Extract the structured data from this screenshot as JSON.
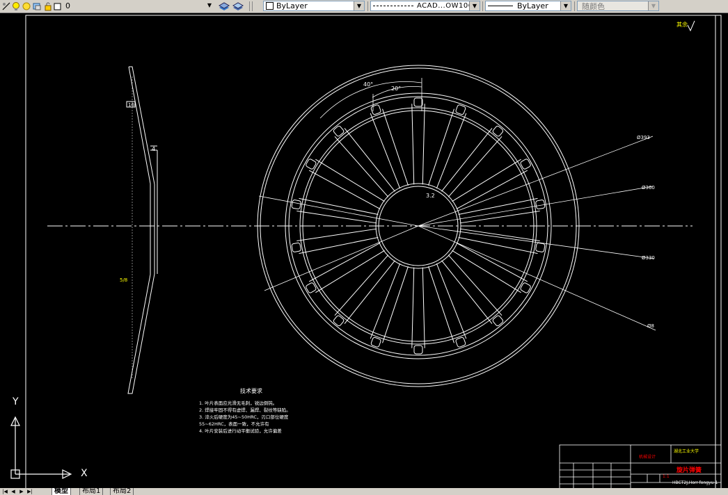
{
  "toolbar": {
    "layer_value": "0",
    "color_value": "ByLayer",
    "linetype_value": "ACAD...OW10C",
    "lineweight_value": "ByLayer",
    "plotstyle_value": "随颜色"
  },
  "tabs": {
    "model": "模型",
    "layout1": "布局1",
    "layout2": "布局2"
  },
  "drawing": {
    "notes_title": "技术要求",
    "notes": [
      "1. 叶片表面应光滑无毛刺，锐边倒钝。",
      "2. 焊接牢固不得有虚焊、漏焊、裂纹等缺陷。",
      "3. 淬火后硬度为45~50HRC，刃口部位硬度",
      "55~62HRC，表面一致，不允许有",
      "4. 叶片安装后进行动平衡试验，允许偏差"
    ],
    "dim_labels": {
      "angle_40": "40°",
      "angle_20": "20°",
      "d_outer": "Ø393",
      "d_mid": "Ø360",
      "d_inner": "Ø330",
      "d_small": "Ø8",
      "r_center": "3.2",
      "side_thick": "4",
      "side_16": "16",
      "side_note": "5/8"
    },
    "title_block": {
      "part_name": "旋片弹簧",
      "drawing_no": "HBCT2J,Horr-fongyu-1",
      "scale": "1:1",
      "org_text_1": "机械设计",
      "company": "湖北工业大学"
    },
    "ucs": {
      "x": "X",
      "y": "Y"
    },
    "roughness": "其余"
  },
  "colors": {
    "line": "#ffffff",
    "accent_yellow": "#ffff00",
    "accent_red": "#ff0000",
    "toolbar_bg": "#d4d0c8"
  }
}
